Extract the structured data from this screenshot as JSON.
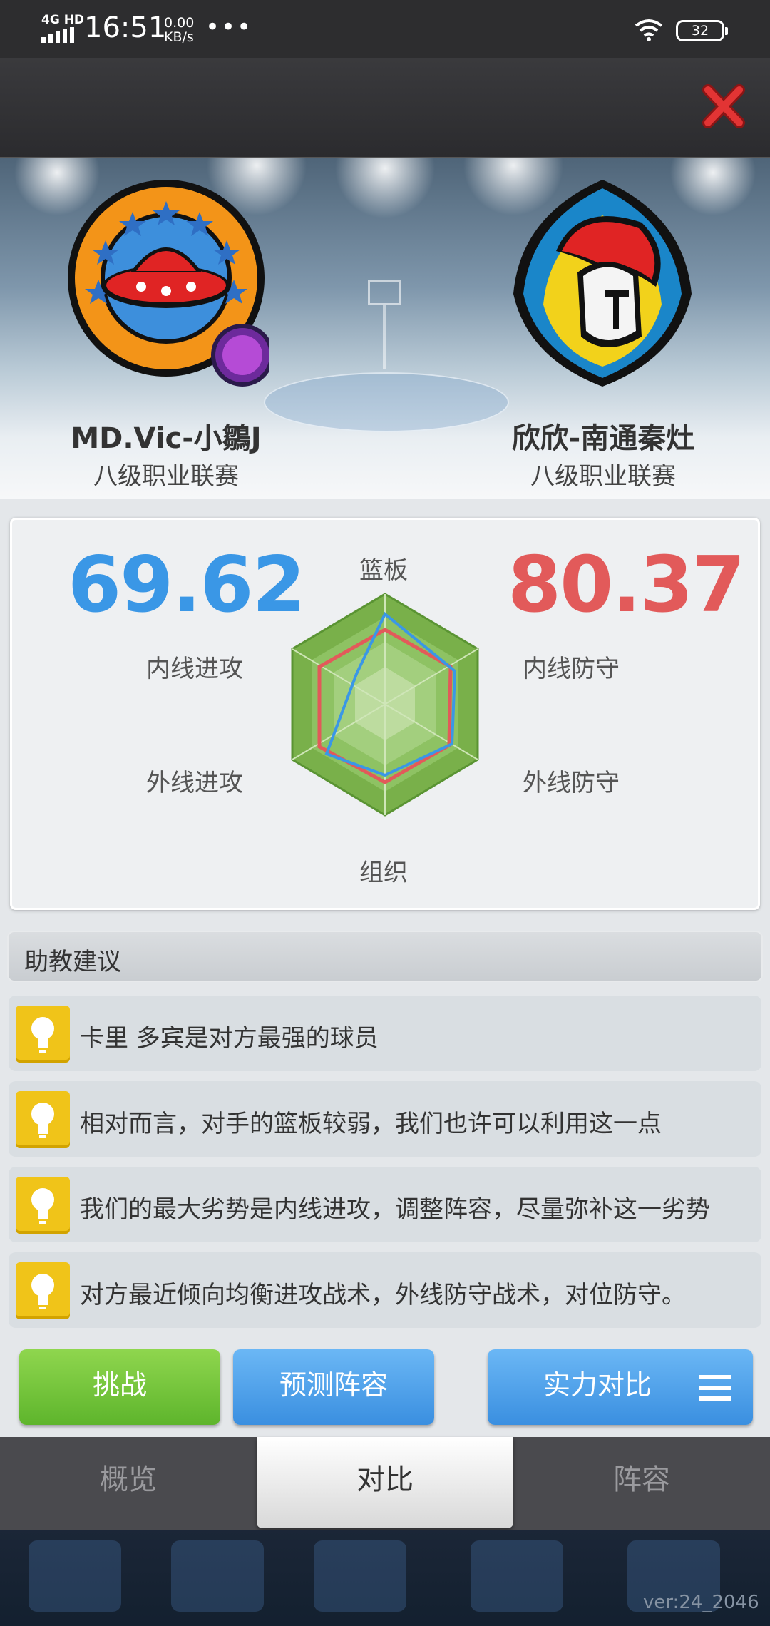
{
  "status_bar": {
    "network": "4G HD",
    "time": "16:51",
    "speed_value": "0.00",
    "speed_unit": "KB/s",
    "more": "•••",
    "battery": "32"
  },
  "home_team": {
    "name": "MD.Vic-小鶵J",
    "league": "八级职业联赛",
    "score": "69.62",
    "color": "#3a97e6"
  },
  "away_team": {
    "name": "欣欣-南通秦灶",
    "league": "八级职业联赛",
    "score": "80.37",
    "color": "#e25a5a"
  },
  "radar": {
    "labels": {
      "top": "篮板",
      "upper_left": "内线进攻",
      "upper_right": "内线防守",
      "lower_left": "外线进攻",
      "lower_right": "外线防守",
      "bottom": "组织"
    }
  },
  "assistant": {
    "title": "助教建议",
    "tips": [
      "卡里 多宾是对方最强的球员",
      "相对而言，对手的篮板较弱，我们也许可以利用这一点",
      "我们的最大劣势是内线进攻，调整阵容，尽量弥补这一劣势",
      "对方最近倾向均衡进攻战术，外线防守战术，对位防守。"
    ]
  },
  "buttons": {
    "challenge": "挑战",
    "predict": "预测阵容",
    "strength": "实力对比"
  },
  "tabs": {
    "overview": "概览",
    "compare": "对比",
    "lineup": "阵容",
    "active": "对比"
  },
  "version": "ver:24_2046"
}
